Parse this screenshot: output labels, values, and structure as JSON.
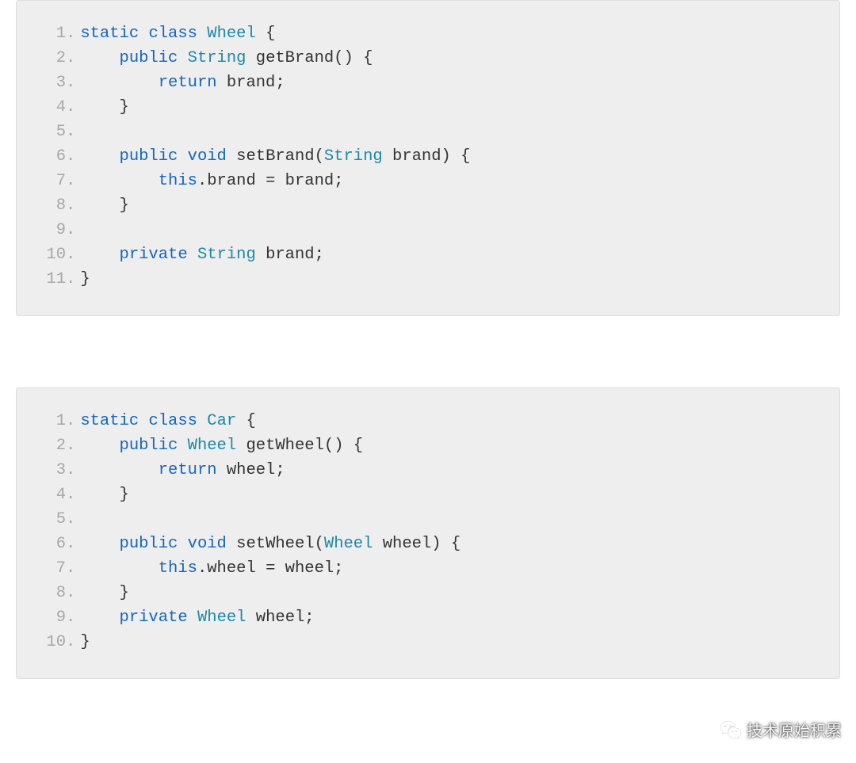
{
  "blocks": [
    {
      "lines": [
        {
          "n": "1",
          "tokens": [
            [
              "kw",
              "static"
            ],
            [
              "id",
              " "
            ],
            [
              "kw",
              "class"
            ],
            [
              "id",
              " "
            ],
            [
              "type",
              "Wheel"
            ],
            [
              "id",
              " {"
            ]
          ]
        },
        {
          "n": "2",
          "tokens": [
            [
              "id",
              "    "
            ],
            [
              "kw",
              "public"
            ],
            [
              "id",
              " "
            ],
            [
              "type",
              "String"
            ],
            [
              "id",
              " getBrand() {"
            ]
          ]
        },
        {
          "n": "3",
          "tokens": [
            [
              "id",
              "        "
            ],
            [
              "kw",
              "return"
            ],
            [
              "id",
              " brand;"
            ]
          ]
        },
        {
          "n": "4",
          "tokens": [
            [
              "id",
              "    }"
            ]
          ]
        },
        {
          "n": "5",
          "tokens": [
            [
              "id",
              ""
            ]
          ]
        },
        {
          "n": "6",
          "tokens": [
            [
              "id",
              "    "
            ],
            [
              "kw",
              "public"
            ],
            [
              "id",
              " "
            ],
            [
              "kw",
              "void"
            ],
            [
              "id",
              " setBrand("
            ],
            [
              "type",
              "String"
            ],
            [
              "id",
              " brand) {"
            ]
          ]
        },
        {
          "n": "7",
          "tokens": [
            [
              "id",
              "        "
            ],
            [
              "kw",
              "this"
            ],
            [
              "id",
              ".brand = brand;"
            ]
          ]
        },
        {
          "n": "8",
          "tokens": [
            [
              "id",
              "    }"
            ]
          ]
        },
        {
          "n": "9",
          "tokens": [
            [
              "id",
              ""
            ]
          ]
        },
        {
          "n": "10",
          "tokens": [
            [
              "id",
              "    "
            ],
            [
              "kw",
              "private"
            ],
            [
              "id",
              " "
            ],
            [
              "type",
              "String"
            ],
            [
              "id",
              " brand;"
            ]
          ]
        },
        {
          "n": "11",
          "tokens": [
            [
              "id",
              "}"
            ]
          ]
        }
      ]
    },
    {
      "lines": [
        {
          "n": "1",
          "tokens": [
            [
              "kw",
              "static"
            ],
            [
              "id",
              " "
            ],
            [
              "kw",
              "class"
            ],
            [
              "id",
              " "
            ],
            [
              "type",
              "Car"
            ],
            [
              "id",
              " {"
            ]
          ]
        },
        {
          "n": "2",
          "tokens": [
            [
              "id",
              "    "
            ],
            [
              "kw",
              "public"
            ],
            [
              "id",
              " "
            ],
            [
              "type",
              "Wheel"
            ],
            [
              "id",
              " getWheel() {"
            ]
          ]
        },
        {
          "n": "3",
          "tokens": [
            [
              "id",
              "        "
            ],
            [
              "kw",
              "return"
            ],
            [
              "id",
              " wheel;"
            ]
          ]
        },
        {
          "n": "4",
          "tokens": [
            [
              "id",
              "    }"
            ]
          ]
        },
        {
          "n": "5",
          "tokens": [
            [
              "id",
              ""
            ]
          ]
        },
        {
          "n": "6",
          "tokens": [
            [
              "id",
              "    "
            ],
            [
              "kw",
              "public"
            ],
            [
              "id",
              " "
            ],
            [
              "kw",
              "void"
            ],
            [
              "id",
              " setWheel("
            ],
            [
              "type",
              "Wheel"
            ],
            [
              "id",
              " wheel) {"
            ]
          ]
        },
        {
          "n": "7",
          "tokens": [
            [
              "id",
              "        "
            ],
            [
              "kw",
              "this"
            ],
            [
              "id",
              ".wheel = wheel;"
            ]
          ]
        },
        {
          "n": "8",
          "tokens": [
            [
              "id",
              "    }"
            ]
          ]
        },
        {
          "n": "9",
          "tokens": [
            [
              "id",
              "    "
            ],
            [
              "kw",
              "private"
            ],
            [
              "id",
              " "
            ],
            [
              "type",
              "Wheel"
            ],
            [
              "id",
              " wheel;"
            ]
          ]
        },
        {
          "n": "10",
          "tokens": [
            [
              "id",
              "}"
            ]
          ]
        }
      ]
    }
  ],
  "watermark": {
    "text": "技术原始积累"
  }
}
